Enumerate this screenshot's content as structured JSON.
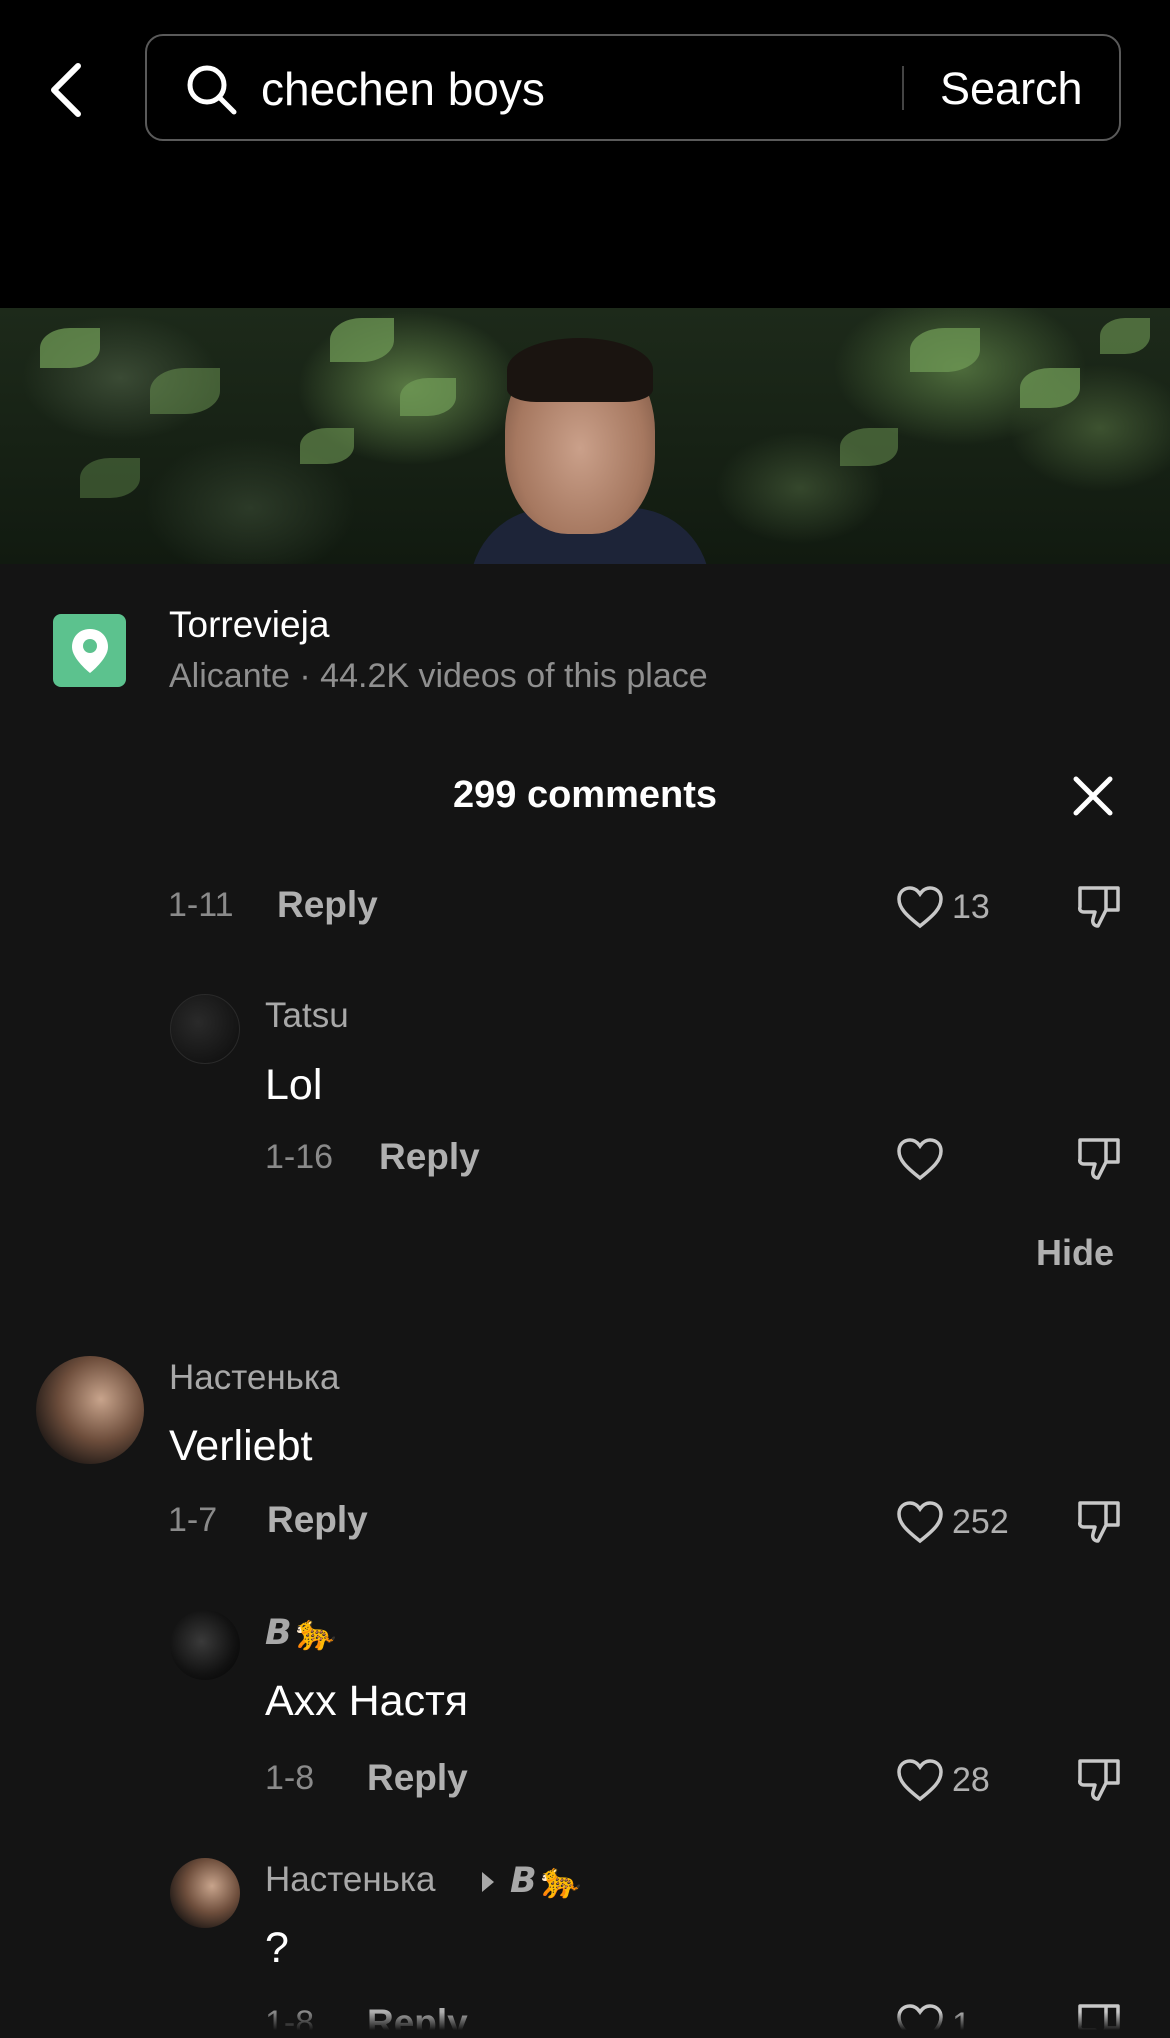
{
  "search": {
    "query": "chechen boys",
    "button_label": "Search"
  },
  "place": {
    "title": "Torrevieja",
    "subtitle": "Alicante · 44.2K videos of this place"
  },
  "comments": {
    "title": "299 comments",
    "hide_label": "Hide",
    "items": [
      {
        "date": "1-11",
        "reply_label": "Reply",
        "likes": "13"
      },
      {
        "user": "Tatsu",
        "text": "Lol",
        "date": "1-16",
        "reply_label": "Reply",
        "likes": ""
      },
      {
        "user": "Настенька",
        "text": "Verliebt",
        "date": "1-7",
        "reply_label": "Reply",
        "likes": "252"
      },
      {
        "user": "𝘽🐆",
        "text": "Ахх Настя",
        "date": "1-8",
        "reply_label": "Reply",
        "likes": "28"
      },
      {
        "user": "Настенька",
        "reply_to": "𝘽🐆",
        "text": "?",
        "date": "1-8",
        "reply_label": "Reply",
        "likes": "1"
      }
    ]
  },
  "colors": {
    "background": "#000000",
    "sheet": "#141414",
    "place_icon": "#5cc28e",
    "muted_text": "#8a8a8a"
  }
}
